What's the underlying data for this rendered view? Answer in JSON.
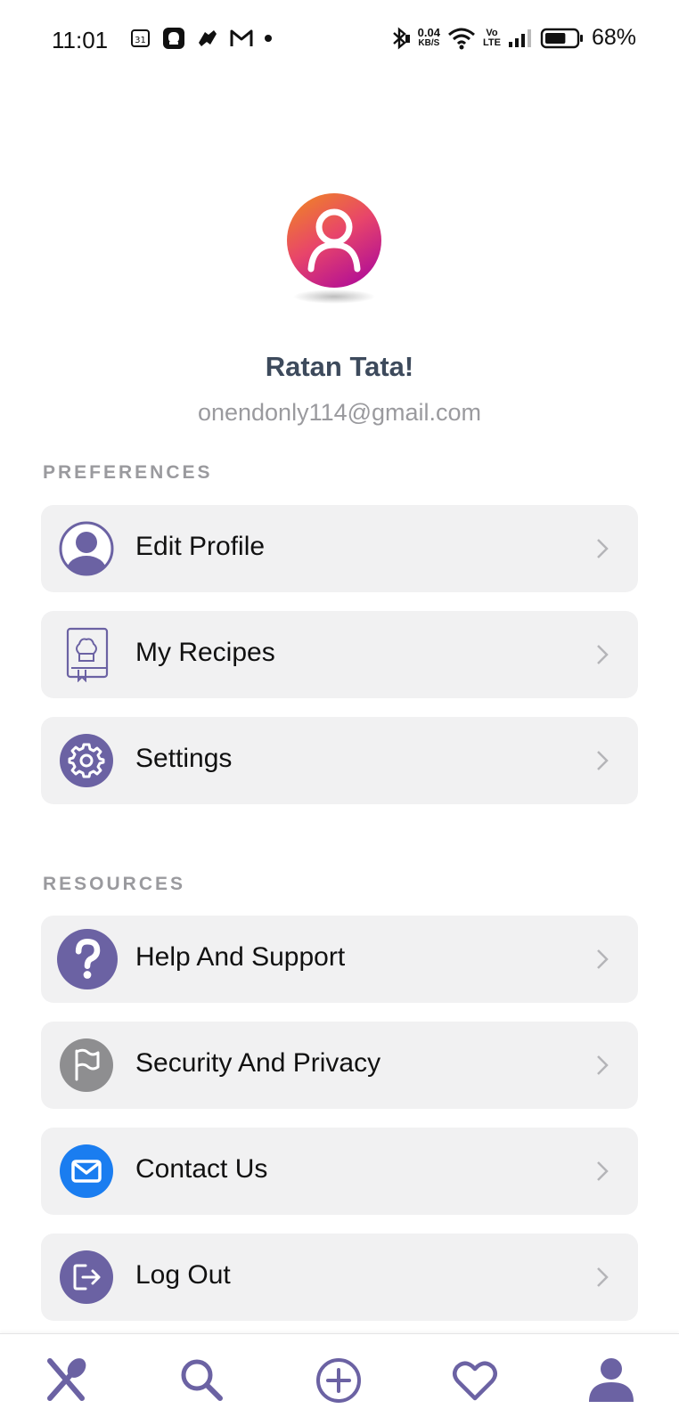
{
  "status_bar": {
    "time": "11:01",
    "calendar_day": "31",
    "net_speed_value": "0.04",
    "net_speed_unit": "KB/S",
    "volte_top": "Vo",
    "volte_bottom": "LTE",
    "battery_percent": "68%",
    "battery_level": 0.68
  },
  "profile": {
    "name": "Ratan Tata!",
    "email": "onendonly114@gmail.com"
  },
  "sections": {
    "preferences": {
      "title": "PREFERENCES",
      "items": [
        {
          "label": "Edit Profile",
          "icon": "user-circle-icon"
        },
        {
          "label": "My Recipes",
          "icon": "recipe-book-icon"
        },
        {
          "label": "Settings",
          "icon": "gear-icon"
        }
      ]
    },
    "resources": {
      "title": "RESOURCES",
      "items": [
        {
          "label": "Help And Support",
          "icon": "question-icon"
        },
        {
          "label": "Security And Privacy",
          "icon": "flag-icon"
        },
        {
          "label": "Contact Us",
          "icon": "mail-icon"
        },
        {
          "label": "Log Out",
          "icon": "logout-icon"
        }
      ]
    }
  },
  "bottom_nav": {
    "items": [
      {
        "icon": "utensils-icon"
      },
      {
        "icon": "search-icon"
      },
      {
        "icon": "add-circle-icon"
      },
      {
        "icon": "heart-icon"
      },
      {
        "icon": "profile-icon",
        "active": true
      }
    ]
  },
  "colors": {
    "accent": "#6b62a3",
    "card_bg": "#f1f1f2",
    "name_text": "#3d4a5c",
    "muted_text": "#9a9a9e",
    "contact_blue": "#1a7df0",
    "security_gray": "#8e8e90",
    "avatar_gradient_start": "#f08a1e",
    "avatar_gradient_end": "#c2188a"
  }
}
